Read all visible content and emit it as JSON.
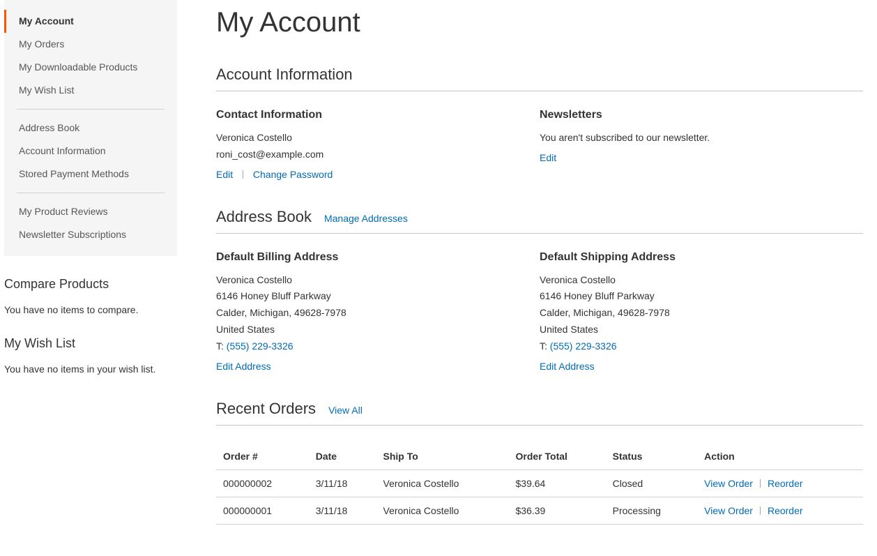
{
  "page": {
    "title": "My Account"
  },
  "sidebar": {
    "nav": [
      {
        "label": "My Account",
        "current": true
      },
      {
        "label": "My Orders"
      },
      {
        "label": "My Downloadable Products"
      },
      {
        "label": "My Wish List"
      },
      {
        "delimiter": true
      },
      {
        "label": "Address Book"
      },
      {
        "label": "Account Information"
      },
      {
        "label": "Stored Payment Methods"
      },
      {
        "delimiter": true
      },
      {
        "label": "My Product Reviews"
      },
      {
        "label": "Newsletter Subscriptions"
      }
    ],
    "compare": {
      "title": "Compare Products",
      "empty": "You have no items to compare."
    },
    "wishlist": {
      "title": "My Wish List",
      "empty": "You have no items in your wish list."
    }
  },
  "account_info": {
    "title": "Account Information",
    "contact": {
      "title": "Contact Information",
      "name": "Veronica Costello",
      "email": "roni_cost@example.com",
      "edit": "Edit",
      "change_password": "Change Password"
    },
    "newsletters": {
      "title": "Newsletters",
      "status": "You aren't subscribed to our newsletter.",
      "edit": "Edit"
    }
  },
  "address_book": {
    "title": "Address Book",
    "manage": "Manage Addresses",
    "billing": {
      "title": "Default Billing Address",
      "name": "Veronica Costello",
      "street": "6146 Honey Bluff Parkway",
      "city_line": "Calder, Michigan, 49628-7978",
      "country": "United States",
      "phone_prefix": "T:",
      "phone": "(555) 229-3326",
      "edit": "Edit Address"
    },
    "shipping": {
      "title": "Default Shipping Address",
      "name": "Veronica Costello",
      "street": "6146 Honey Bluff Parkway",
      "city_line": "Calder, Michigan, 49628-7978",
      "country": "United States",
      "phone_prefix": "T:",
      "phone": "(555) 229-3326",
      "edit": "Edit Address"
    }
  },
  "recent_orders": {
    "title": "Recent Orders",
    "view_all": "View All",
    "columns": {
      "order": "Order #",
      "date": "Date",
      "ship_to": "Ship To",
      "total": "Order Total",
      "status": "Status",
      "action": "Action"
    },
    "actions": {
      "view": "View Order",
      "reorder": "Reorder"
    },
    "rows": [
      {
        "order": "000000002",
        "date": "3/11/18",
        "ship_to": "Veronica Costello",
        "total": "$39.64",
        "status": "Closed"
      },
      {
        "order": "000000001",
        "date": "3/11/18",
        "ship_to": "Veronica Costello",
        "total": "$36.39",
        "status": "Processing"
      }
    ]
  }
}
